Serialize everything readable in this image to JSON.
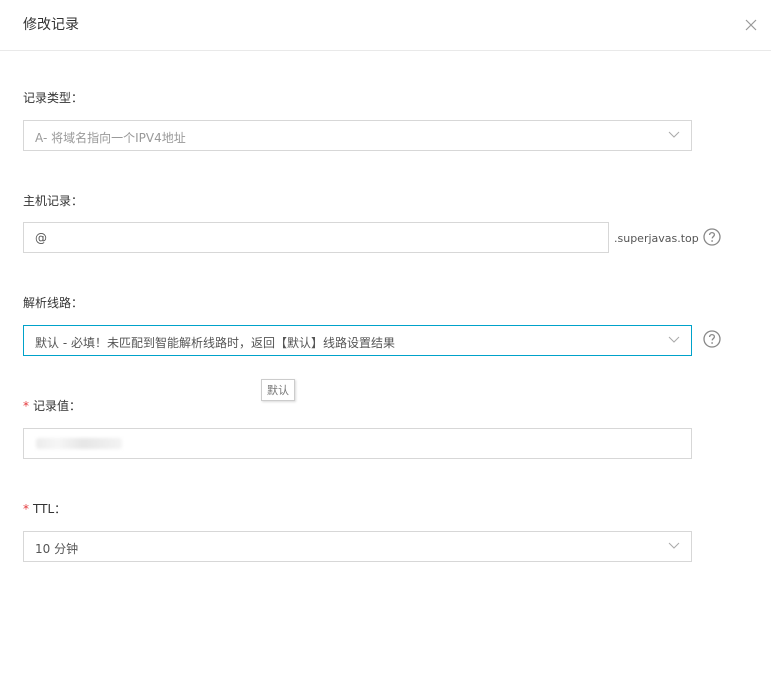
{
  "header": {
    "title": "修改记录"
  },
  "record_type": {
    "label": "记录类型：",
    "value": "A- 将域名指向一个IPV4地址"
  },
  "host_record": {
    "label": "主机记录：",
    "value": "@",
    "suffix": ".superjavas.top"
  },
  "line": {
    "label": "解析线路：",
    "value": "默认 - 必填！未匹配到智能解析线路时，返回【默认】线路设置结果",
    "tooltip": "默认"
  },
  "record_value": {
    "label": "记录值：",
    "required_mark": "*"
  },
  "ttl": {
    "label": "TTL：",
    "required_mark": "*",
    "value": "10 分钟"
  },
  "icons": {
    "close": "close-icon",
    "dropdown": "chevron-down-icon",
    "help": "question-circle-icon"
  },
  "colors": {
    "focus_border": "#00a2ca",
    "required": "#e4393c",
    "border": "#d7d7d7"
  }
}
